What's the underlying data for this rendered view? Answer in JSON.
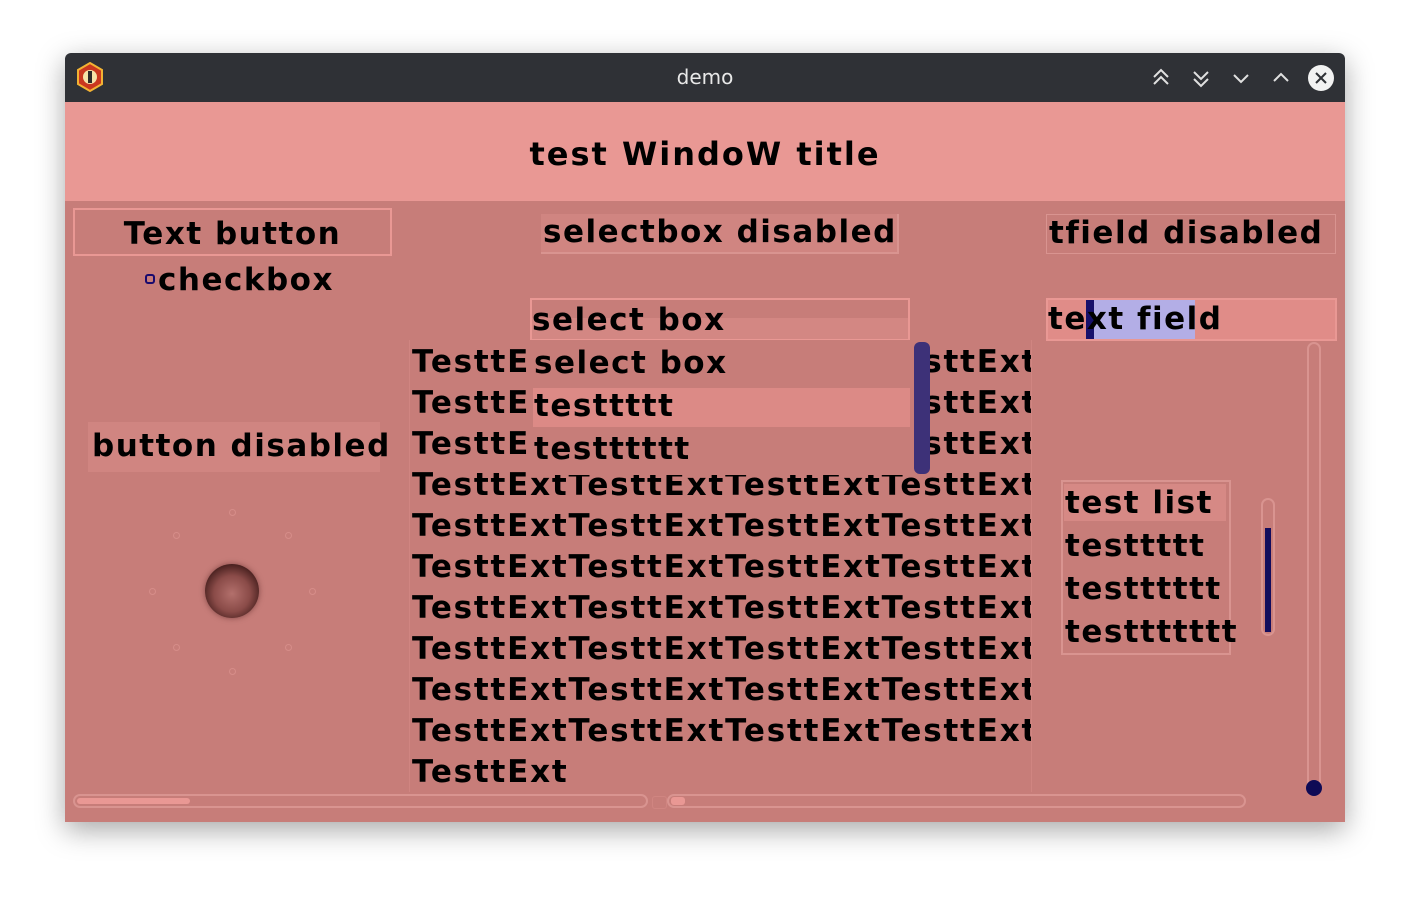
{
  "window": {
    "title": "demo",
    "buttons": [
      "keep-above-icon",
      "keep-below-icon",
      "minimize-icon",
      "maximize-icon",
      "close-icon"
    ]
  },
  "app": {
    "window_title": "test WindoW title"
  },
  "controls": {
    "text_button": "Text button",
    "checkbox_label": "checkbox",
    "checkbox_checked": false,
    "selectbox_disabled": "selectbox disabled",
    "tfield_disabled": "tfield disabled",
    "selectbox_value": "select box",
    "textfield_value": "text field",
    "button_disabled": "button disabled"
  },
  "dropdown": {
    "options": [
      "select box",
      "testtttt",
      "testttttt"
    ],
    "highlighted_index": 1
  },
  "textarea": {
    "lines": [
      "TesttExtTesttExtTesttExtTesttExt",
      "TesttExtTesttExtTesttExtTesttExt",
      "TesttExtTesttExtTesttExtTesttExt",
      "TesttExtTesttExtTesttExtTesttExt",
      "TesttExtTesttExtTesttExtTesttExt",
      "TesttExtTesttExtTesttExtTesttExt",
      "TesttExtTesttExtTesttExtTesttExt",
      "TesttExtTesttExtTesttExtTesttExt",
      "TesttExtTesttExtTesttExtTesttExt",
      "TesttExtTesttExtTesttExtTesttExt",
      "TesttExt"
    ]
  },
  "list": {
    "items": [
      "test list",
      "testtttt",
      "testttttt",
      "testtttttt"
    ],
    "selected_index": 0
  },
  "colors": {
    "titlebar": "#2f3136",
    "header": "#e99894",
    "background": "#c77d79",
    "accent": "#120c5c",
    "selection": "#b3aee6"
  }
}
